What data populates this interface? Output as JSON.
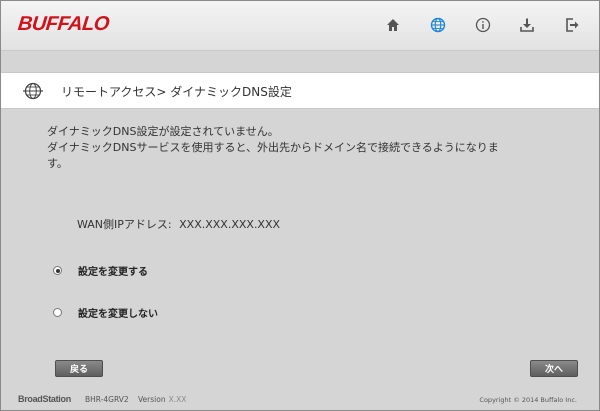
{
  "header": {
    "logo_text": "BUFFALO",
    "brand_color": "#d0121b",
    "nav_icons": [
      "home-icon",
      "globe-icon",
      "info-icon",
      "download-icon",
      "logout-icon"
    ],
    "active_icon_color": "#1e88d2",
    "icon_color": "#555555"
  },
  "breadcrumb": {
    "icon": "globe-icon",
    "text": "リモートアクセス> ダイナミックDNS設定"
  },
  "content": {
    "message_line1": "ダイナミックDNS設定が設定されていません。",
    "message_line2": "ダイナミックDNSサービスを使用すると、外出先からドメイン名で接続できるようになりま",
    "message_line3": "す。",
    "wan_label": "WAN側IPアドレス:",
    "wan_value": "XXX.XXX.XXX.XXX",
    "options": [
      {
        "label": "設定を変更する",
        "selected": true
      },
      {
        "label": "設定を変更しない",
        "selected": false
      }
    ]
  },
  "buttons": {
    "back_label": "戻る",
    "next_label": "次へ"
  },
  "footer": {
    "brand": "BroadStation",
    "model": "BHR-4GRV2",
    "version_label": "Version",
    "version_value": "X.XX",
    "copyright": "Copyright © 2014 Buffalo Inc."
  }
}
